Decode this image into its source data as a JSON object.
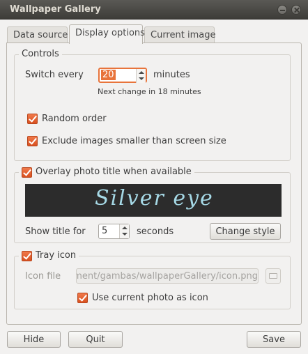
{
  "window": {
    "title": "Wallpaper Gallery"
  },
  "tabs": [
    {
      "label": "Data source"
    },
    {
      "label": "Display options"
    },
    {
      "label": "Current image"
    }
  ],
  "controls": {
    "legend": "Controls",
    "switch_label": "Switch every",
    "switch_value": "20",
    "switch_unit": "minutes",
    "next_change": "Next change in 18 minutes",
    "random_label": "Random order",
    "random_checked": true,
    "exclude_label": "Exclude images smaller than screen size",
    "exclude_checked": true
  },
  "overlay": {
    "label": "Overlay photo title when available",
    "checked": true,
    "preview_text": "Silver  eye",
    "show_label": "Show title for",
    "show_value": "5",
    "show_unit": "seconds",
    "change_style": "Change style"
  },
  "tray": {
    "label": "Tray icon",
    "checked": true,
    "icon_file_label": "Icon file",
    "icon_file_value": "pment/gambas/wallpaperGallery/icon.png",
    "use_current_label": "Use current photo as icon",
    "use_current_checked": true
  },
  "footer": {
    "hide": "Hide",
    "quit": "Quit",
    "save": "Save"
  },
  "colors": {
    "accent": "#e8743b",
    "titlebar": "#3d3c38",
    "banner_bg": "#2c2c2c",
    "banner_text": "#a6d9e6"
  },
  "icons": [
    "minimize-icon",
    "close-icon",
    "folder-icon",
    "checkmark-icon",
    "spin-up-icon",
    "spin-down-icon"
  ]
}
